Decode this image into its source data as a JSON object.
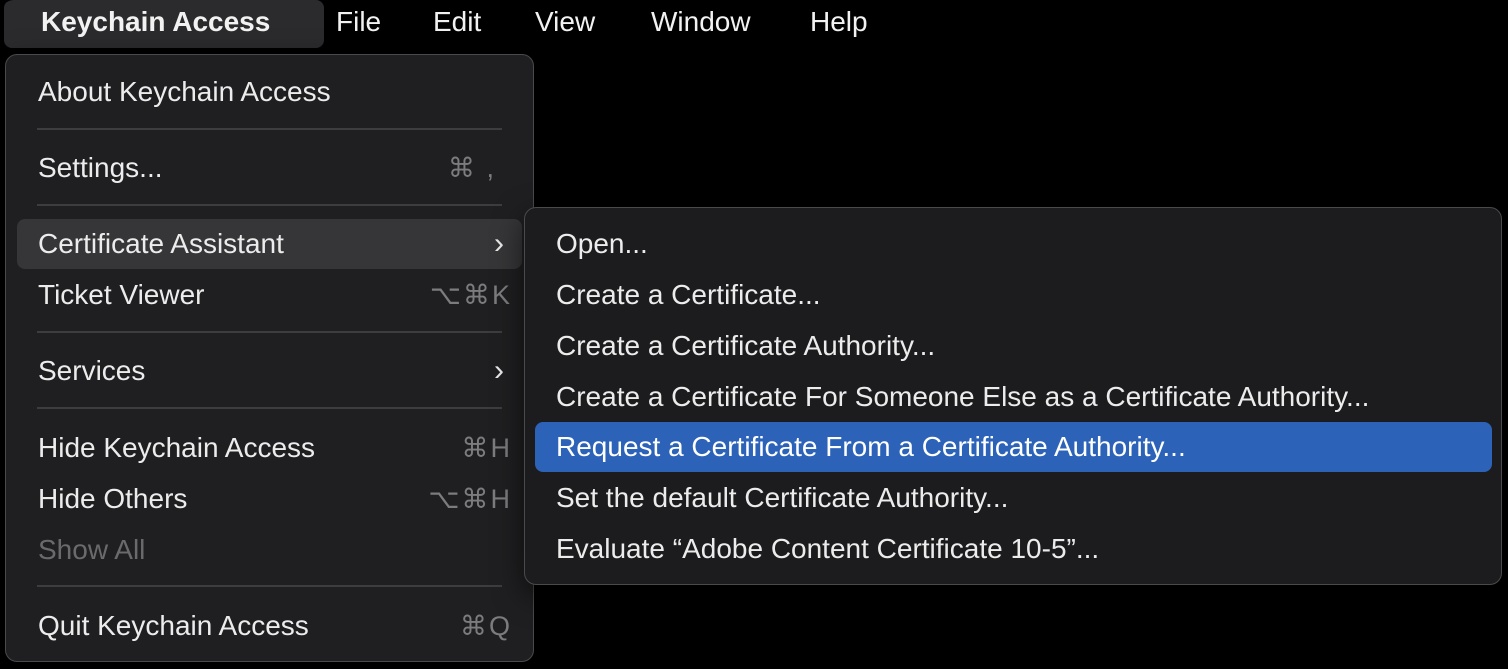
{
  "menubar": {
    "app": "Keychain Access",
    "items": [
      "File",
      "Edit",
      "View",
      "Window",
      "Help"
    ]
  },
  "main_menu": {
    "about": "About Keychain Access",
    "settings": {
      "label": "Settings...",
      "shortcut": "⌘ ,"
    },
    "certificate_assistant": {
      "label": "Certificate Assistant",
      "chevron": "›"
    },
    "ticket_viewer": {
      "label": "Ticket Viewer",
      "shortcut": "⌥⌘K"
    },
    "services": {
      "label": "Services",
      "chevron": "›"
    },
    "hide": {
      "label": "Hide Keychain Access",
      "shortcut": "⌘H"
    },
    "hide_others": {
      "label": "Hide Others",
      "shortcut": "⌥⌘H"
    },
    "show_all": "Show All",
    "quit": {
      "label": "Quit Keychain Access",
      "shortcut": "⌘Q"
    }
  },
  "sub_menu": {
    "items": [
      "Open...",
      "Create a Certificate...",
      "Create a Certificate Authority...",
      "Create a Certificate For Someone Else as a Certificate Authority...",
      "Request a Certificate From a Certificate Authority...",
      "Set the default Certificate Authority...",
      "Evaluate “Adobe Content Certificate 10-5”..."
    ],
    "selected_index": 4
  },
  "colors": {
    "selection": "#2c62b8",
    "menu_bg": "#1f1f21",
    "hover": "#363638"
  }
}
